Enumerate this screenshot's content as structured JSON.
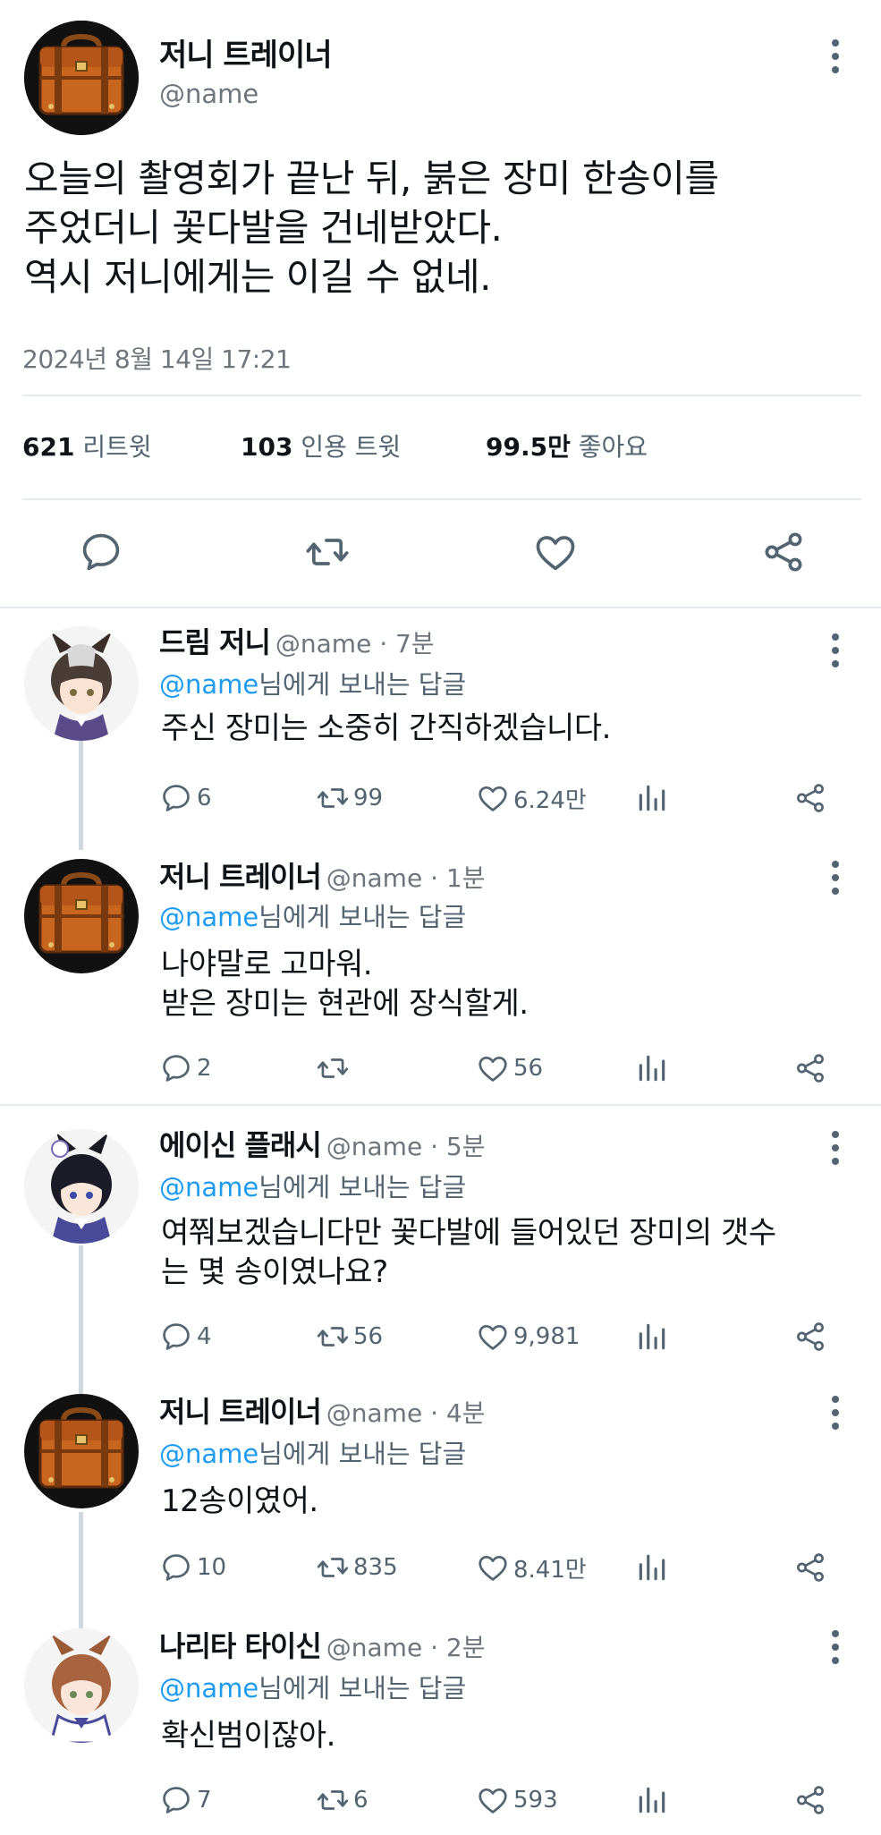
{
  "main_tweet": {
    "name": "저니 트레이너",
    "handle": "@name",
    "text_lines": [
      "오늘의 촬영회가 끝난 뒤, 붉은 장미 한송이를",
      "주었더니 꽃다발을 건네받았다.",
      "역시 저니에게는 이길 수 없네."
    ],
    "timestamp": "2024년 8월 14일  17:21",
    "stats": {
      "retweets_count": "621",
      "retweets_label": "리트윗",
      "quotes_count": "103",
      "quotes_label": "인용 트윗",
      "likes_count": "99.5만",
      "likes_label": "좋아요"
    },
    "avatar_icon": "suitcase-avatar"
  },
  "reply_to_prefix": "@name",
  "reply_to_suffix": "님에게 보내는 답글",
  "replies": [
    {
      "name": "드림 저니",
      "meta": "@name · 7분",
      "text_lines": [
        "주신 장미는 소중히 간직하겠습니다."
      ],
      "reply_count": "6",
      "retweet_count": "99",
      "like_count": "6.24만",
      "avatar_icon": "horse-girl-gray-hair-avatar"
    },
    {
      "name": "저니 트레이너",
      "meta": "@name · 1분",
      "text_lines": [
        "나야말로 고마워.",
        "받은 장미는 현관에 장식할게."
      ],
      "reply_count": "2",
      "retweet_count": "",
      "like_count": "56",
      "avatar_icon": "suitcase-avatar"
    },
    {
      "name": "에이신 플래시",
      "meta": "@name · 5분",
      "text_lines": [
        "여쭤보겠습니다만 꽃다발에 들어있던 장미의 갯수",
        "는 몇 송이였나요?"
      ],
      "reply_count": "4",
      "retweet_count": "56",
      "like_count": "9,981",
      "avatar_icon": "horse-girl-dark-hair-avatar"
    },
    {
      "name": "저니 트레이너",
      "meta": "@name · 4분",
      "text_lines": [
        "12송이였어."
      ],
      "reply_count": "10",
      "retweet_count": "835",
      "like_count": "8.41만",
      "avatar_icon": "suitcase-avatar"
    },
    {
      "name": "나리타 타이신",
      "meta": "@name · 2분",
      "text_lines": [
        "확신범이잖아."
      ],
      "reply_count": "7",
      "retweet_count": "6",
      "like_count": "593",
      "avatar_icon": "horse-girl-brown-hair-avatar"
    }
  ],
  "colors": {
    "text": "#0f1419",
    "secondary": "#536471",
    "mention": "#1d9bf0",
    "divider": "#e6ecf0",
    "thread_line": "#cfd9de"
  }
}
